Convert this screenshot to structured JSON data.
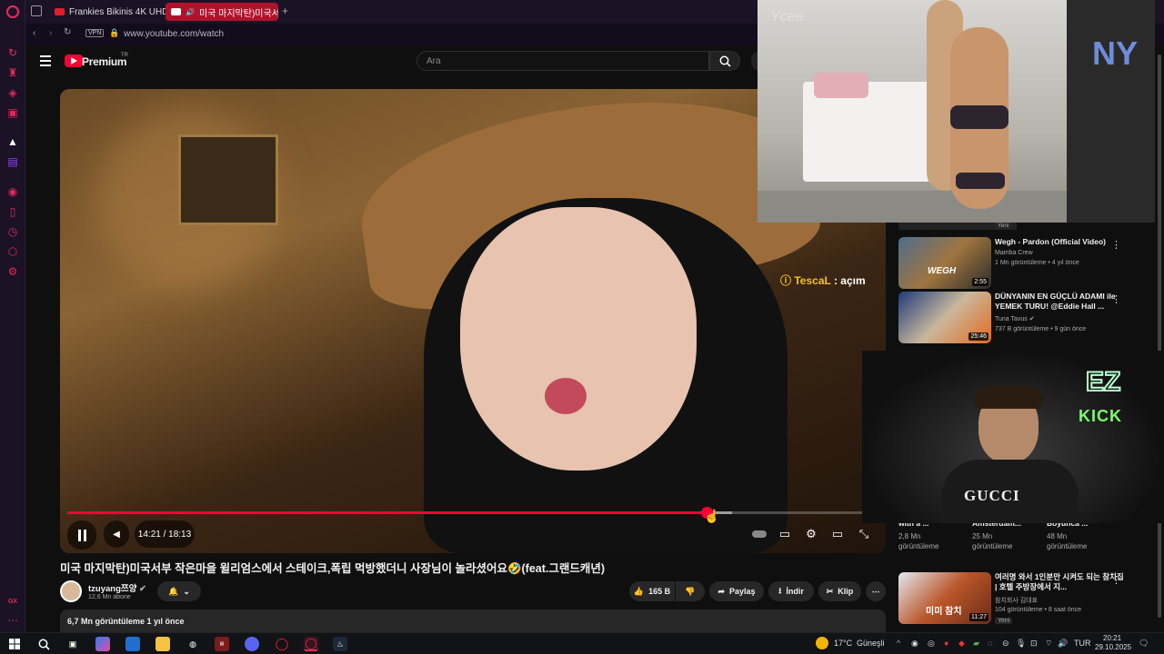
{
  "tabs": [
    {
      "label": "Frankies Bikinis 4K UHD"
    },
    {
      "label": "미국 마지막탄)미국서"
    }
  ],
  "new_tab_symbol": "+",
  "address": {
    "vpn_label": "VPN",
    "url": "www.youtube.com/watch"
  },
  "youtube": {
    "logo_text": "Premium",
    "logo_badge": "TR",
    "search_placeholder": "Ara",
    "accent_color": "#ff0033"
  },
  "player": {
    "time": "14:21 / 18:13",
    "progress_fraction": 0.788,
    "chat_username": "TescaL",
    "chat_message": ": açım"
  },
  "video": {
    "title": "미국 마지막탄)미국서부 작은마을 윌리엄스에서 스테이크,폭립 먹방했더니 사장님이 놀라셨어요🤣(feat.그랜드캐년)",
    "channel": "tzuyang쯔양",
    "subscribers": "12,6 Mn abone",
    "likes": "165 B",
    "share_label": "Paylaş",
    "download_label": "İndir",
    "clip_label": "Klip",
    "more_label": "⋯",
    "views_line": "6,7 Mn görüntüleme  1 yıl önce"
  },
  "recommendations": [
    {
      "title": "Wegh - Pardon (Official Video)",
      "channel": "Mamba Crew",
      "meta": "1 Mn görüntüleme • 4 yıl önce",
      "duration": "2:55",
      "thumb_text": "WEGH"
    },
    {
      "title": "DÜNYANIN EN GÜÇLÜ ADAMI ile YEMEK TURU! @Eddie Hall ...",
      "channel": "Tuna Tavus",
      "meta": "737 B görüntüleme • 9 gün önce",
      "duration": "25:46",
      "thumb_text": ""
    },
    {
      "title": "여러명 와서 1인분만 시켜도 되는 참치집 | 호텔 주방장에서 지...",
      "channel": "참치회사 김대표",
      "meta": "104 görüntüleme • 8 saat önce",
      "duration": "11:27",
      "thumb_text": "미미 참치",
      "badge": "Yeni"
    }
  ],
  "partial_top_badge": "Yeni",
  "partial_row": [
    {
      "title": "with a ...",
      "meta": "2,8 Mn görüntüleme"
    },
    {
      "title": "Amsterdam...",
      "meta": "25 Mn görüntüleme"
    },
    {
      "title": "Boyunca ...",
      "meta": "48 Mn görüntüleme"
    }
  ],
  "webcam": {
    "logo_top": "EZ",
    "logo_bottom": "KICK",
    "shirt_text": "GUCCI"
  },
  "runway": {
    "watermark": "Ycee",
    "sign": "NY"
  },
  "taskbar": {
    "weather": "17°C",
    "weather_label": "Güneşli",
    "language": "TUR",
    "time": "20:21",
    "date": "29.10.2025"
  }
}
